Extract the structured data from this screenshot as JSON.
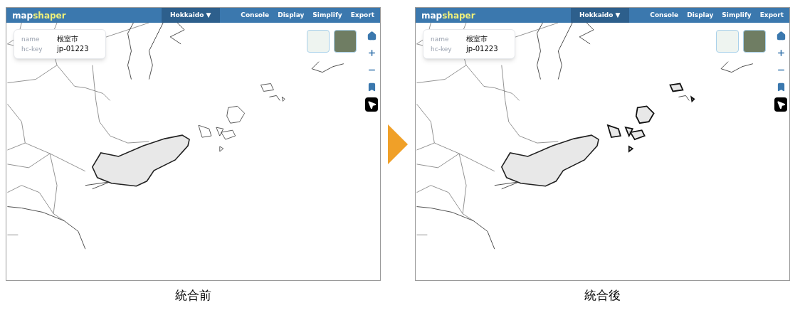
{
  "panels": [
    {
      "app": {
        "logo_main": "map",
        "logo_accent": "shaper",
        "layer_menu": "Hokkaido ▼",
        "menu": [
          "Console",
          "Display",
          "Simplify",
          "Export"
        ]
      },
      "info": [
        {
          "label": "name",
          "value": "根室市"
        },
        {
          "label": "hc-key",
          "value": "jp-01223"
        }
      ],
      "tools": [
        {
          "kind": "home",
          "selected": false
        },
        {
          "kind": "zoom_in",
          "selected": false
        },
        {
          "kind": "zoom_out",
          "selected": false
        },
        {
          "kind": "bookmark",
          "selected": false
        },
        {
          "kind": "pointer",
          "selected": true
        }
      ],
      "islands_highlighted": false,
      "caption": "統合前"
    },
    {
      "app": {
        "logo_main": "map",
        "logo_accent": "shaper",
        "layer_menu": "Hokkaido ▼",
        "menu": [
          "Console",
          "Display",
          "Simplify",
          "Export"
        ]
      },
      "info": [
        {
          "label": "name",
          "value": "根室市"
        },
        {
          "label": "hc-key",
          "value": "jp-01223"
        }
      ],
      "tools": [
        {
          "kind": "home",
          "selected": false
        },
        {
          "kind": "zoom_in",
          "selected": false
        },
        {
          "kind": "zoom_out",
          "selected": false
        },
        {
          "kind": "bookmark",
          "selected": false
        },
        {
          "kind": "pointer",
          "selected": true
        }
      ],
      "islands_highlighted": true,
      "caption": "統合後"
    }
  ]
}
